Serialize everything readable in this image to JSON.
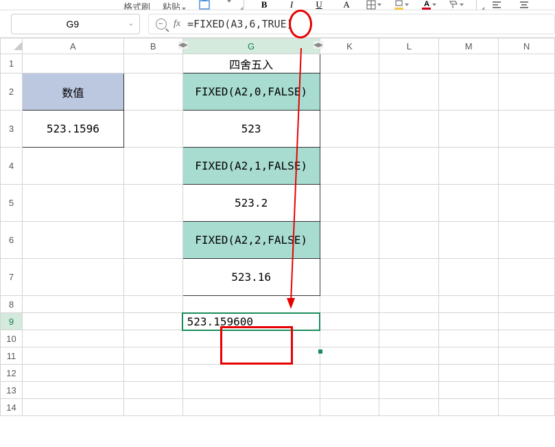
{
  "toolbar": {
    "btn1": "格式刷",
    "btn2": "粘贴"
  },
  "namebox": {
    "value": "G9"
  },
  "formula": {
    "fx": "fx",
    "value": "=FIXED(A3,6,TRUE)"
  },
  "columns": [
    "A",
    "B",
    "G",
    "K",
    "L",
    "M",
    "N"
  ],
  "rows": [
    "1",
    "2",
    "3",
    "4",
    "5",
    "6",
    "7",
    "8",
    "9",
    "10",
    "11",
    "12",
    "13",
    "14"
  ],
  "cells": {
    "G1": "四舍五入",
    "A2": "数值",
    "G2": "FIXED(A2,0,FALSE)",
    "A3": "523.1596",
    "G3": "523",
    "G4": "FIXED(A2,1,FALSE)",
    "G5": "523.2",
    "G6": "FIXED(A2,2,FALSE)",
    "G7": "523.16",
    "G9": "523.159600"
  },
  "selected": {
    "col": "G",
    "row": "9"
  }
}
